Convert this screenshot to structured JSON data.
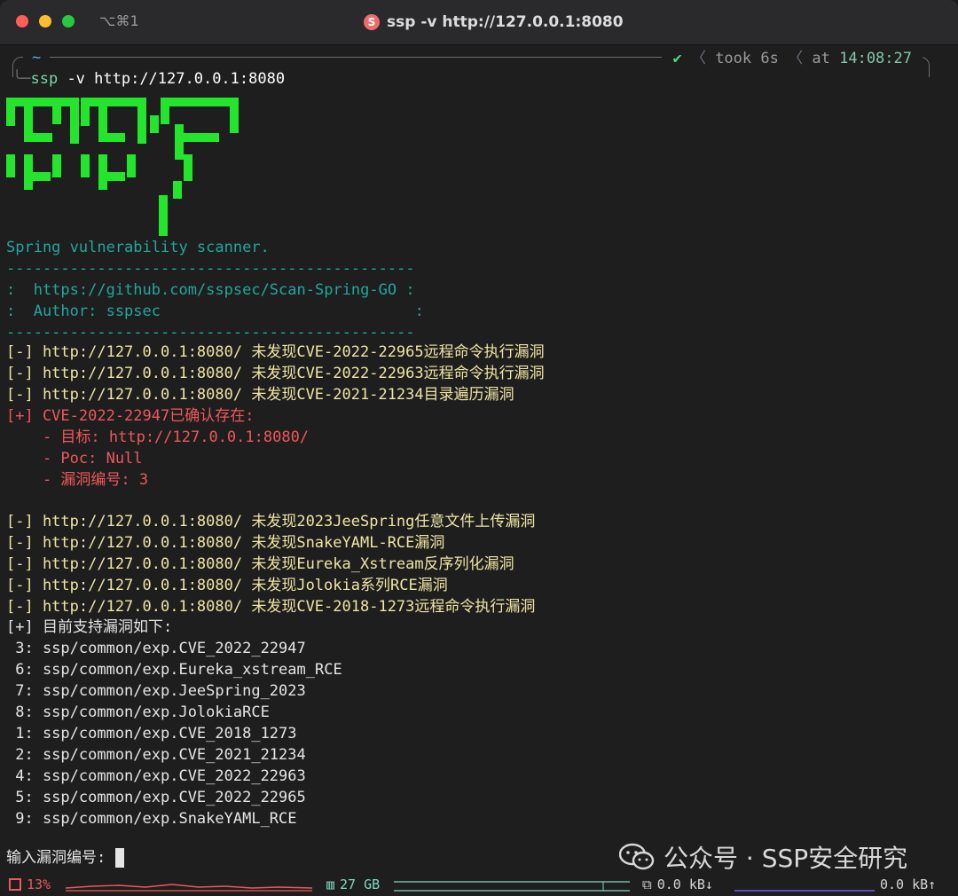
{
  "titlebar": {
    "shortcut": "⌥⌘1",
    "app_icon_letter": "S",
    "title": "ssp -v http://127.0.0.1:8080"
  },
  "prompt": {
    "cwd": "~",
    "command_prefix": "ssp",
    "command_rest": " -v http://127.0.0.1:8080",
    "status_check": "✔",
    "took_label": "took",
    "took_value": "6s",
    "at_label": "at",
    "at_value": "14:08:27"
  },
  "banner": {
    "logo_alt": "SSP",
    "tagline": "Spring vulnerability scanner.",
    "rule": "---------------------------------------------",
    "repo_line": ":  https://github.com/sspsec/Scan-Spring-GO :",
    "author_line": ":  Author: sspsec                            :"
  },
  "output": {
    "results_a": [
      "[-] http://127.0.0.1:8080/ 未发现CVE-2022-22965远程命令执行漏洞",
      "[-] http://127.0.0.1:8080/ 未发现CVE-2022-22963远程命令执行漏洞",
      "[-] http://127.0.0.1:8080/ 未发现CVE-2021-21234目录遍历漏洞"
    ],
    "found": {
      "header": "[+] CVE-2022-22947已确认存在:",
      "target": "    - 目标: http://127.0.0.1:8080/",
      "poc": "    - Poc: Null",
      "vuln_id": "    - 漏洞编号: 3"
    },
    "results_b": [
      "[-] http://127.0.0.1:8080/ 未发现2023JeeSpring任意文件上传漏洞",
      "[-] http://127.0.0.1:8080/ 未发现SnakeYAML-RCE漏洞",
      "[-] http://127.0.0.1:8080/ 未发现Eureka_Xstream反序列化漏洞",
      "[-] http://127.0.0.1:8080/ 未发现Jolokia系列RCE漏洞",
      "[-] http://127.0.0.1:8080/ 未发现CVE-2018-1273远程命令执行漏洞"
    ],
    "supported_header": "[+] 目前支持漏洞如下:",
    "supported": [
      " 3: ssp/common/exp.CVE_2022_22947",
      " 6: ssp/common/exp.Eureka_xstream_RCE",
      " 7: ssp/common/exp.JeeSpring_2023",
      " 8: ssp/common/exp.JolokiaRCE",
      " 1: ssp/common/exp.CVE_2018_1273",
      " 2: ssp/common/exp.CVE_2021_21234",
      " 4: ssp/common/exp.CVE_2022_22963",
      " 5: ssp/common/exp.CVE_2022_22965",
      " 9: ssp/common/exp.SnakeYAML_RCE"
    ],
    "input_prompt": "输入漏洞编号:"
  },
  "watermark": {
    "text": "公众号 · SSP安全研究"
  },
  "statusbar": {
    "cpu": "13%",
    "memory": "27 GB",
    "net_down": "0.0 kB↓",
    "net_up": "0.0 kB↑"
  },
  "colors": {
    "logo_green": "#23e52b",
    "teal": "#22a79d",
    "yellow": "#efe5a3",
    "red": "#f0575a",
    "cpu_graph": "#f0575a",
    "mem_graph": "#7fd8c0",
    "net_graph": "#6b5cf6"
  }
}
